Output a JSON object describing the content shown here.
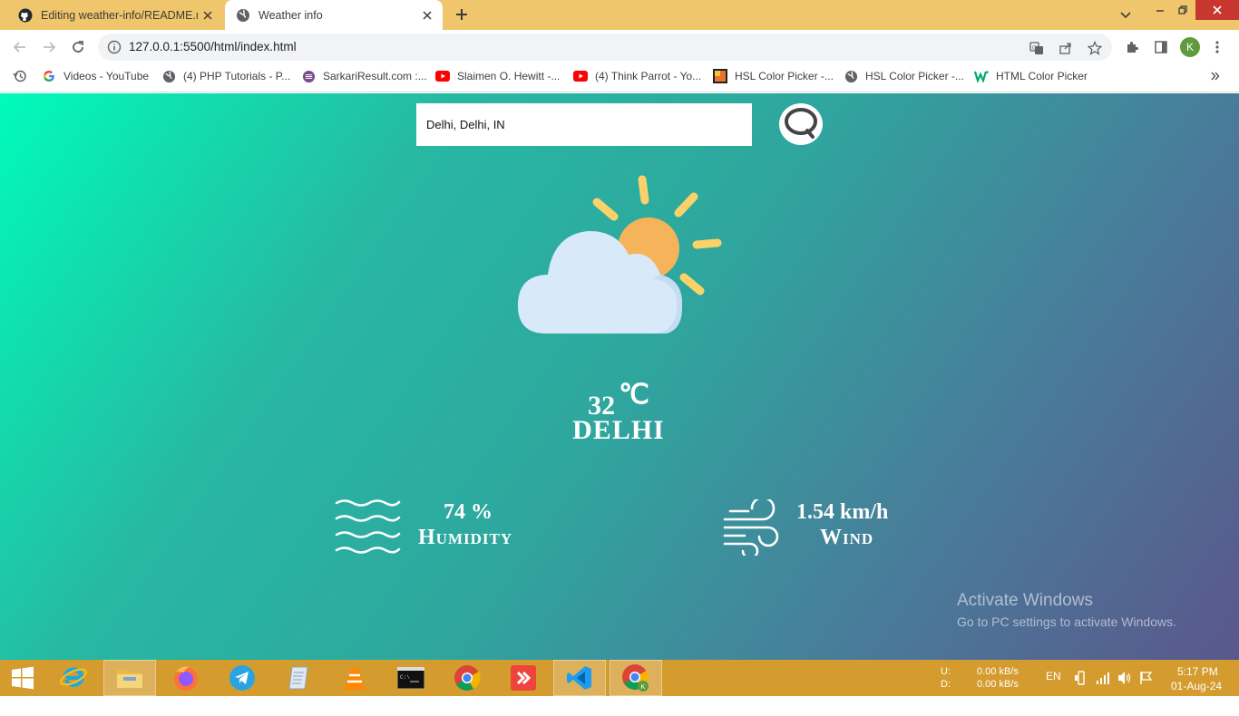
{
  "browser": {
    "tabs": [
      {
        "title": "Editing weather-info/README.m",
        "icon": "github-icon",
        "active": false
      },
      {
        "title": "Weather info",
        "icon": "globe-icon",
        "active": true
      }
    ],
    "url": "127.0.0.1:5500/html/index.html",
    "profile_initial": "K",
    "bookmarks": [
      {
        "label": "Videos - YouTube",
        "icon": "google-icon"
      },
      {
        "label": "(4) PHP Tutorials - P...",
        "icon": "globe-icon"
      },
      {
        "label": "SarkariResult.com :...",
        "icon": "sarkari-icon"
      },
      {
        "label": "Slaimen O. Hewitt -...",
        "icon": "youtube-icon"
      },
      {
        "label": "(4) Think Parrot - Yo...",
        "icon": "youtube-icon"
      },
      {
        "label": "HSL Color Picker -...",
        "icon": "hsl-icon"
      },
      {
        "label": "HSL Color Picker -...",
        "icon": "globe-icon"
      },
      {
        "label": "HTML Color Picker",
        "icon": "w-icon"
      }
    ]
  },
  "weather": {
    "search_value": "Delhi, Delhi, IN",
    "temperature": "32",
    "temperature_unit": "℃",
    "city": "DELHI",
    "humidity_value": "74 %",
    "humidity_label": "Humidity",
    "wind_value": "1.54 km/h",
    "wind_label": "Wind",
    "condition_icon": "partly-cloudy-icon"
  },
  "watermark": {
    "title": "Activate Windows",
    "subtitle": "Go to PC settings to activate Windows."
  },
  "taskbar": {
    "apps": [
      "start-icon",
      "internet-explorer-icon",
      "file-explorer-icon",
      "firefox-icon",
      "telegram-icon",
      "notepad-icon",
      "vlc-icon",
      "cmd-icon",
      "chrome-icon",
      "anydesk-icon",
      "vscode-icon",
      "chrome-profile-icon"
    ],
    "net_up_label": "U:",
    "net_down_label": "D:",
    "net_up": "0.00 kB/s",
    "net_down": "0.00 kB/s",
    "language": "EN",
    "time": "5:17 PM",
    "date": "01-Aug-24"
  },
  "colors": {
    "tab_strip": "#f0c66c",
    "taskbar": "#d49c2e",
    "gradient_start": "#00fbbb",
    "gradient_end": "#5a578c",
    "sun": "#f6b45a",
    "sun_rays": "#fbd269",
    "cloud": "#d8e9f9"
  }
}
